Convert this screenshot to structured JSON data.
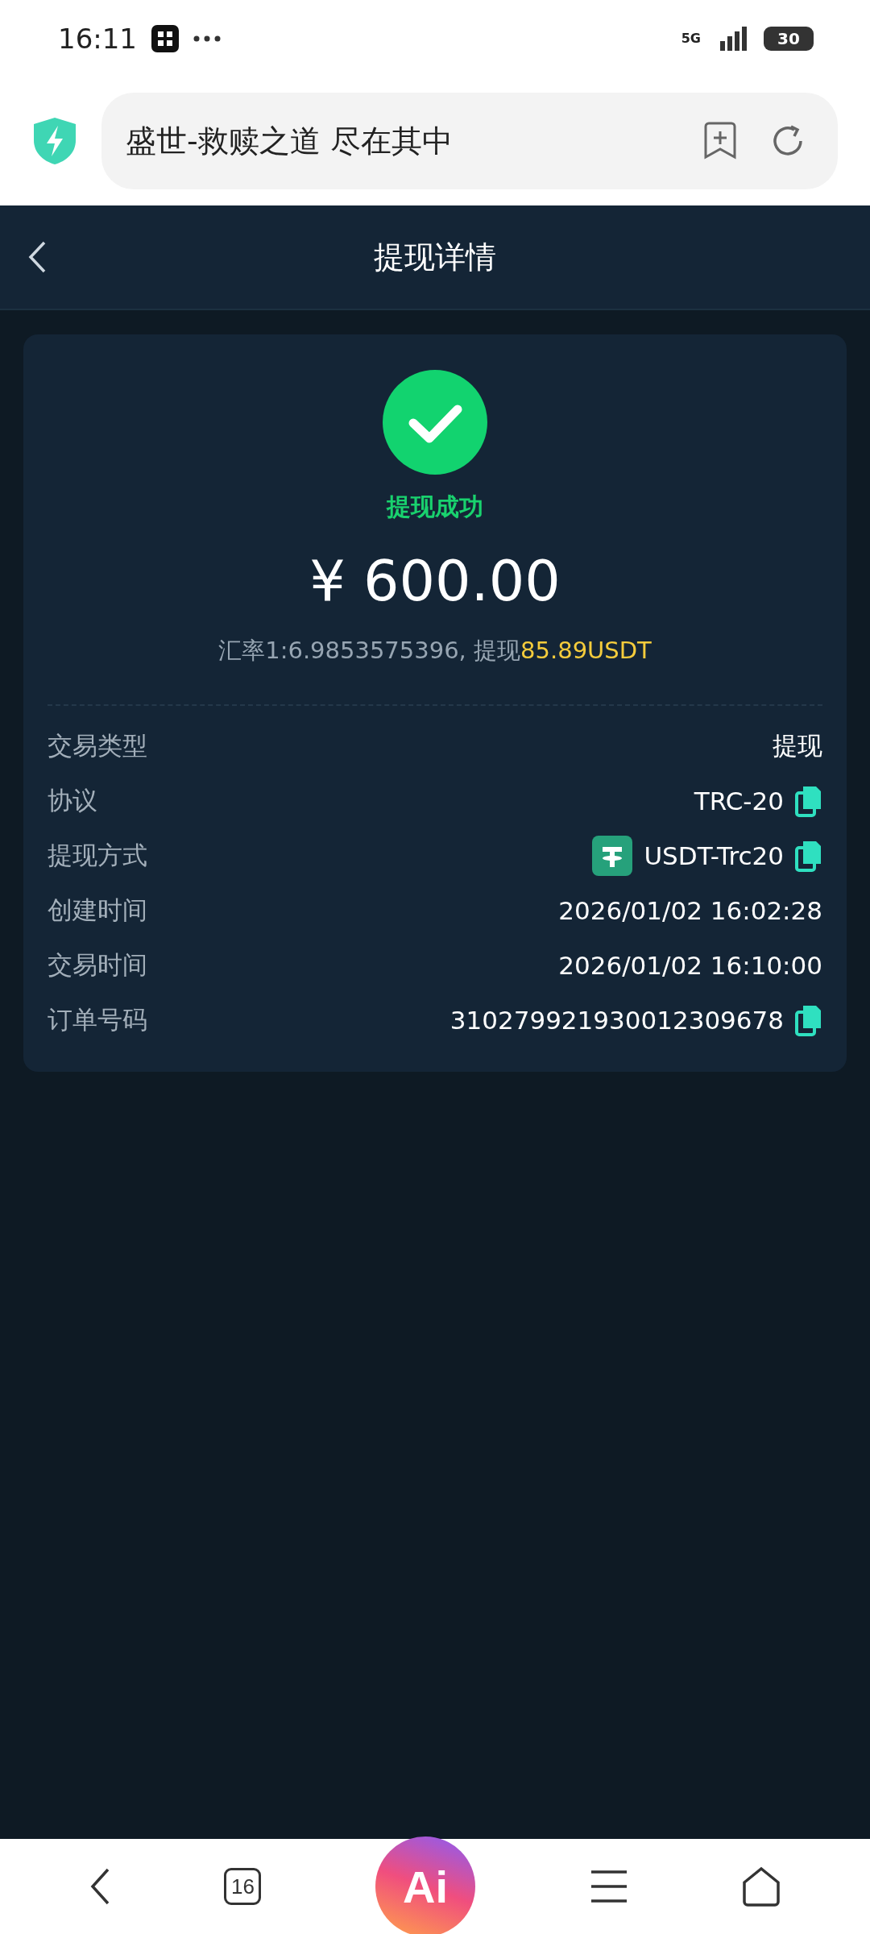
{
  "status_bar": {
    "time": "16:11",
    "network": "5G",
    "battery": "30"
  },
  "browser": {
    "page_title": "盛世-救赎之道 尽在其中"
  },
  "header": {
    "title": "提现详情"
  },
  "result": {
    "status": "提现成功",
    "amount": "¥ 600.00",
    "rate_text": "汇率1:6.9853575396, 提现",
    "usdt_amount": "85.89USDT"
  },
  "details": [
    {
      "label": "交易类型",
      "value": "提现",
      "kind": "plain"
    },
    {
      "label": "协议",
      "value": "TRC-20",
      "kind": "copy"
    },
    {
      "label": "提现方式",
      "value": "USDT-Trc20",
      "kind": "token"
    },
    {
      "label": "创建时间",
      "value": "2026/01/02 16:02:28",
      "kind": "plain"
    },
    {
      "label": "交易时间",
      "value": "2026/01/02 16:10:00",
      "kind": "plain"
    },
    {
      "label": "订单号码",
      "value": "310279921930012309678",
      "kind": "copy"
    }
  ],
  "bottom_nav": {
    "tab_count": "16",
    "ai_label": "Ai"
  }
}
